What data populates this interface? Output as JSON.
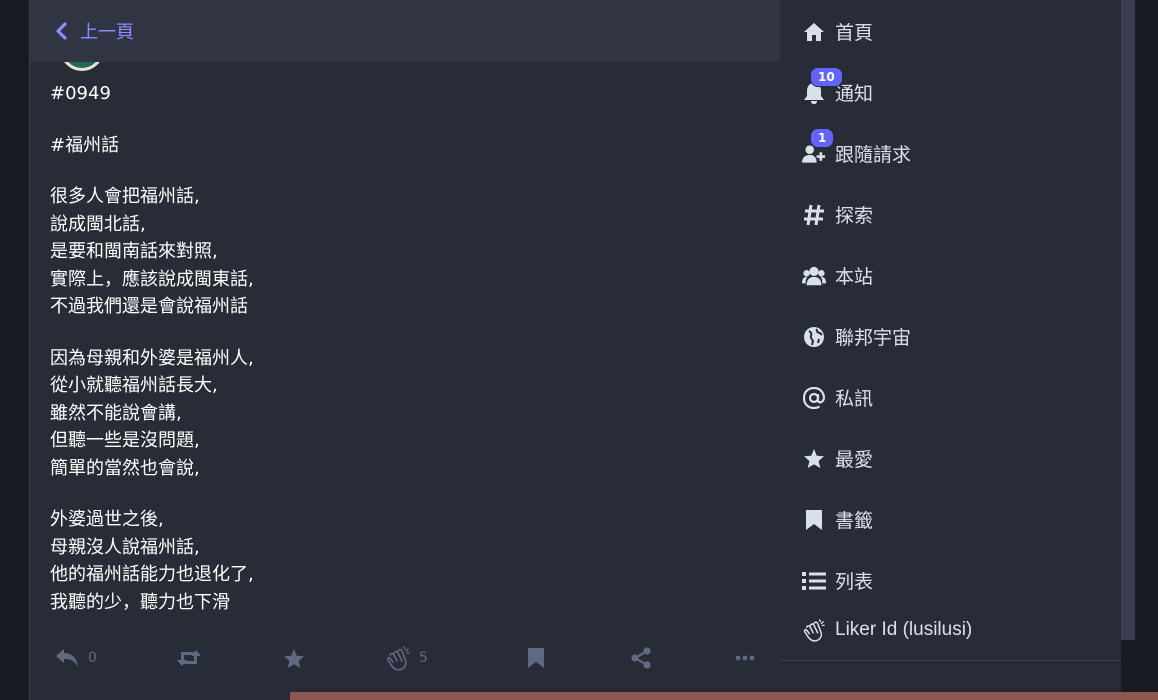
{
  "header": {
    "back_label": "上一頁"
  },
  "status": {
    "paragraphs": [
      [
        "#0949"
      ],
      [
        "#福州話"
      ],
      [
        "很多人會把福州話,",
        "說成閩北話,",
        "是要和閩南話來對照,",
        "實際上，應該說成閩東話,",
        "不過我們還是會說福州話"
      ],
      [
        "因為母親和外婆是福州人,",
        "從小就聽福州話長大,",
        "雖然不能說會講,",
        "但聽一些是沒問題,",
        "簡單的當然也會說,"
      ],
      [
        "外婆過世之後,",
        "母親沒人說福州話,",
        "他的福州話能力也退化了,",
        "我聽的少，聽力也下滑"
      ]
    ]
  },
  "actions": {
    "reply_count": "0",
    "like_count": "5"
  },
  "nav": {
    "items": [
      {
        "label": "首頁",
        "icon": "home-icon"
      },
      {
        "label": "通知",
        "icon": "bell-icon",
        "badge": "10"
      },
      {
        "label": "跟隨請求",
        "icon": "user-plus-icon",
        "badge": "1"
      },
      {
        "label": "探索",
        "icon": "hashtag-icon"
      },
      {
        "label": "本站",
        "icon": "users-icon"
      },
      {
        "label": "聯邦宇宙",
        "icon": "globe-icon"
      },
      {
        "label": "私訊",
        "icon": "at-icon"
      },
      {
        "label": "最愛",
        "icon": "star-icon"
      },
      {
        "label": "書籤",
        "icon": "bookmark-icon"
      },
      {
        "label": "列表",
        "icon": "list-icon"
      },
      {
        "label": "Liker Id (lusilusi)",
        "icon": "clap-icon"
      }
    ]
  },
  "colors": {
    "accent": "#8c8dff",
    "badge": "#6364ff",
    "column_bg": "#282c37",
    "header_bg": "#313543",
    "icon_muted": "#606984"
  }
}
